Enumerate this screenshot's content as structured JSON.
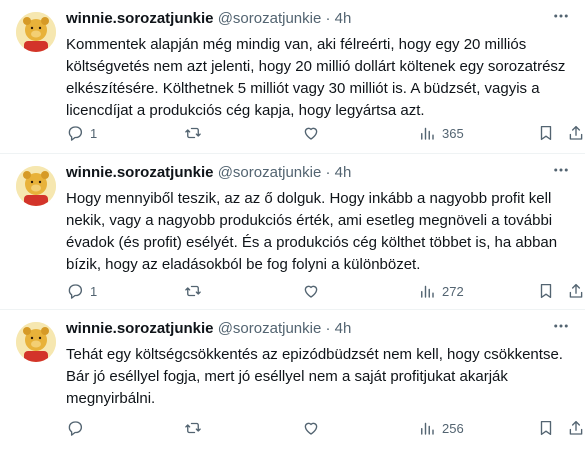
{
  "tweets": [
    {
      "name": "winnie.sorozatjunkie",
      "handle": "@sorozatjunkie",
      "dot": "·",
      "time": "4h",
      "text": "Kommentek alapján még mindig van, aki félreérti, hogy egy 20 milliós költségvetés nem azt jelenti, hogy 20 millió dollárt költenek egy sorozatrész elkészítésére. Költhetnek 5 milliót vagy 30 milliót is. A büdzsét, vagyis a licencdíjat a produkciós cég kapja, hogy legyártsa azt.",
      "reply_count": "1",
      "retweet_count": "",
      "like_count": "",
      "views": "365"
    },
    {
      "name": "winnie.sorozatjunkie",
      "handle": "@sorozatjunkie",
      "dot": "·",
      "time": "4h",
      "text": "Hogy mennyiből teszik, az az ő dolguk. Hogy inkább a nagyobb profit kell nekik, vagy a nagyobb produkciós érték, ami esetleg megnöveli a további évadok (és profit) esélyét. És a produkciós cég költhet többet is, ha abban bízik, hogy az eladásokból be fog folyni a különbözet.",
      "reply_count": "1",
      "retweet_count": "",
      "like_count": "",
      "views": "272"
    },
    {
      "name": "winnie.sorozatjunkie",
      "handle": "@sorozatjunkie",
      "dot": "·",
      "time": "4h",
      "text": "Tehát egy költségcsökkentés az epizódbüdzsét nem kell, hogy csökkentse. Bár jó eséllyel fogja, mert jó eséllyel nem a saját profitjukat akarják megnyirbálni.",
      "reply_count": "",
      "retweet_count": "",
      "like_count": "",
      "views": "256"
    }
  ],
  "icons": {
    "more": "more-dots-icon",
    "reply": "reply-icon",
    "retweet": "retweet-icon",
    "like": "heart-icon",
    "views": "views-chart-icon",
    "bookmark": "bookmark-icon",
    "share": "share-icon"
  },
  "colors": {
    "text_primary": "#0f1419",
    "text_secondary": "#536471",
    "divider": "#eff3f4"
  }
}
